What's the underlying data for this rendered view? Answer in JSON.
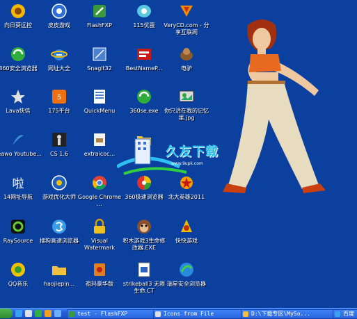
{
  "desktop": {
    "icons": [
      {
        "label": "向日葵远控",
        "glyph": "sunflower-icon"
      },
      {
        "label": "皮皮游戏",
        "glyph": "pipi-game-icon"
      },
      {
        "label": "FlashFXP",
        "glyph": "flashfxp-icon"
      },
      {
        "label": "115优蛋",
        "glyph": "115-icon"
      },
      {
        "label": "VeryCD.com - 分享互联网",
        "glyph": "verycd-icon"
      },
      {
        "label": "360安全浏览器",
        "glyph": "360-browser-icon"
      },
      {
        "label": "网址大全",
        "glyph": "ie-icon"
      },
      {
        "label": "Snagit32",
        "glyph": "snagit-icon"
      },
      {
        "label": "BestNameP...",
        "glyph": "bestname-icon"
      },
      {
        "label": "电驴",
        "glyph": "emule-icon"
      },
      {
        "label": "Lava快信",
        "glyph": "lava-icon"
      },
      {
        "label": "175平台",
        "glyph": "175-icon"
      },
      {
        "label": "QuickMenu",
        "glyph": "quickmenu-icon"
      },
      {
        "label": "360se.exe",
        "glyph": "360se-icon"
      },
      {
        "label": "你只活在我的记忆里.jpg",
        "glyph": "jpg-icon"
      },
      {
        "label": "Leawo Youtube...",
        "glyph": "leawo-icon"
      },
      {
        "label": "CS 1.6",
        "glyph": "cs-icon"
      },
      {
        "label": "extraicoc...",
        "glyph": "extraicon-icon"
      },
      {
        "label": "",
        "glyph": "folder-icon"
      },
      {
        "label": "",
        "glyph": "blank-icon"
      },
      {
        "label": "14网址导航",
        "glyph": "nav-icon"
      },
      {
        "label": "游戏优化大师",
        "glyph": "game-optimizer-icon"
      },
      {
        "label": "Google Chrome ...",
        "glyph": "chrome-icon"
      },
      {
        "label": "360极速浏览器",
        "glyph": "360-extreme-icon"
      },
      {
        "label": "北大英雄2011",
        "glyph": "hero-icon"
      },
      {
        "label": "RaySource",
        "glyph": "raysource-icon"
      },
      {
        "label": "搜狗高速浏览器",
        "glyph": "sogou-icon"
      },
      {
        "label": "Visual Watermark",
        "glyph": "lock-icon"
      },
      {
        "label": "积木游戏3生命修改器.EXE",
        "glyph": "monkey-icon"
      },
      {
        "label": "快快游戏",
        "glyph": "kuaikuai-icon"
      },
      {
        "label": "QQ音乐",
        "glyph": "qqmusic-icon"
      },
      {
        "label": "haojiepin...",
        "glyph": "folder-icon"
      },
      {
        "label": "祖玛豪华版",
        "glyph": "zuma-icon"
      },
      {
        "label": "strikeball3 无限生命.CT",
        "glyph": "ct-file-icon"
      },
      {
        "label": "瑞星安全浏览器",
        "glyph": "rising-browser-icon"
      }
    ]
  },
  "watermark": {
    "text": "久友下载",
    "url": "www.9upk.com"
  },
  "taskbar": {
    "tasks": [
      {
        "label": "test - FlashFXP"
      },
      {
        "label": "Icons from File"
      },
      {
        "label": "D:\\下载专区\\MySo..."
      },
      {
        "label": "百度"
      }
    ]
  },
  "colors": {
    "desktop": "#0b409f",
    "taskbar": "#245edb",
    "start": "#2e8b2e"
  }
}
